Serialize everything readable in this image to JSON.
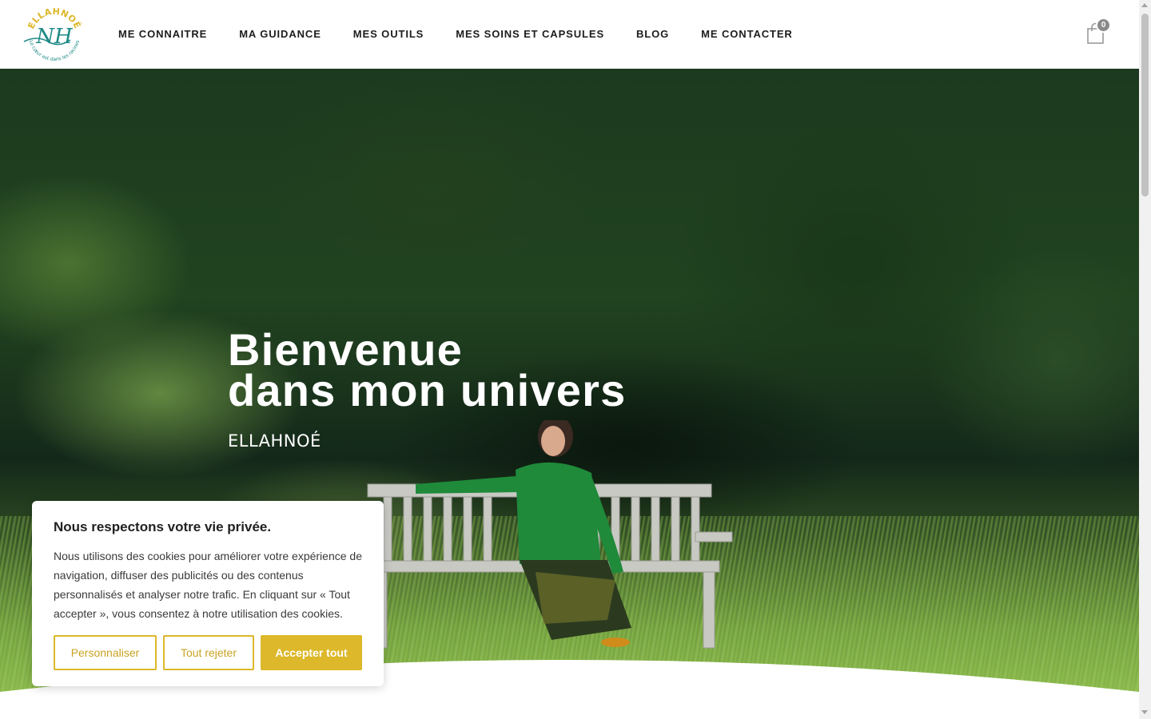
{
  "header": {
    "logo_top_text": "ELLAHNOÉ",
    "logo_initials": "NH",
    "logo_tagline": "Le cœur est dans les racines",
    "nav": [
      {
        "label": "ME CONNAITRE"
      },
      {
        "label": "MA GUIDANCE"
      },
      {
        "label": "MES OUTILS"
      },
      {
        "label": "MES SOINS ET CAPSULES"
      },
      {
        "label": "BLOG"
      },
      {
        "label": "ME CONTACTER"
      }
    ],
    "cart_icon": "shopping-bag-icon",
    "cart_count": "0"
  },
  "hero": {
    "title_line1": "Bienvenue",
    "title_line2": "dans mon univers",
    "signature": "ELLAHNOÉ"
  },
  "cookie": {
    "title": "Nous respectons votre vie privée.",
    "text": "Nous utilisons des cookies pour améliorer votre expérience de navigation, diffuser des publicités ou des contenus personnalisés et analyser notre trafic. En cliquant sur « Tout accepter », vous consentez à notre utilisation des cookies.",
    "btn_customize": "Personnaliser",
    "btn_reject": "Tout rejeter",
    "btn_accept": "Accepter tout"
  },
  "colors": {
    "accent_gold": "#dcb82a",
    "logo_teal": "#1e8a86",
    "nav_text": "#1d1d1d",
    "cart_badge": "#8a8a8a"
  }
}
